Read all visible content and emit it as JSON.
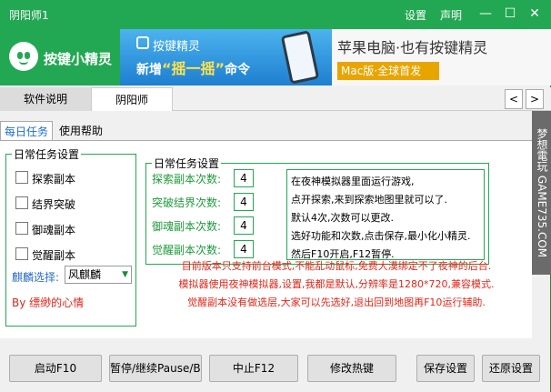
{
  "window": {
    "title": "阴阳师1",
    "menu_settings": "设置",
    "menu_declare": "声明",
    "min": "—",
    "max": "☐",
    "close": "✕"
  },
  "brand": {
    "name": "按键小精灵"
  },
  "banner": {
    "brand": "按键精灵",
    "slogan_prefix": "新增",
    "slogan_highlight": "“摇一摇”",
    "slogan_suffix": "命令",
    "headline": "苹果电脑·也有按键精灵",
    "mac_tag": "Mac版·全球首发"
  },
  "tabs": {
    "software": "软件说明",
    "yys": "阴阳师",
    "prev": "<",
    "next": ">"
  },
  "inner_tabs": {
    "daily": "每日任务",
    "help": "使用帮助"
  },
  "daily_group": {
    "title": "日常任务设置",
    "items": [
      {
        "label": "探索副本",
        "checked": false
      },
      {
        "label": "结界突破",
        "checked": false
      },
      {
        "label": "御魂副本",
        "checked": false
      },
      {
        "label": "觉醒副本",
        "checked": false
      }
    ],
    "qilin_label": "麒麟选择:",
    "qilin_value": "风麒麟",
    "credit": "By 缥缈的心情"
  },
  "count_group": {
    "title": "日常任务设置",
    "rows": [
      {
        "label": "探索副本次数:",
        "value": "4"
      },
      {
        "label": "突破结界次数:",
        "value": "4"
      },
      {
        "label": "御魂副本次数:",
        "value": "4"
      },
      {
        "label": "觉醒副本次数:",
        "value": "4"
      }
    ],
    "instructions": [
      "在夜神模拟器里面运行游戏,",
      "点开探索,来到探索地图里就可以了.",
      "默认4次,次数可以更改.",
      "选好功能和次数,点击保存,最小化小精灵.",
      "然后F10开启,F12暂停."
    ]
  },
  "notice": [
    "目前版本只支持前台模式,不能乱动鼠标,免费大漠绑定不了夜神的后台.",
    "模拟器使用夜神模拟器,设置,我都是默认,分辨率是1280*720,兼容模式.",
    "觉醒副本没有做选层,大家可以先选好,退出回到地图再F10运行辅助."
  ],
  "watermark": "梦想電玩 GAME735.COM",
  "buttons": {
    "start": "启动F10",
    "pause": "暂停/继续Pause/Break",
    "stop": "中止F12",
    "hotkey": "修改热键",
    "save": "保存设置",
    "restore": "还原设置"
  }
}
